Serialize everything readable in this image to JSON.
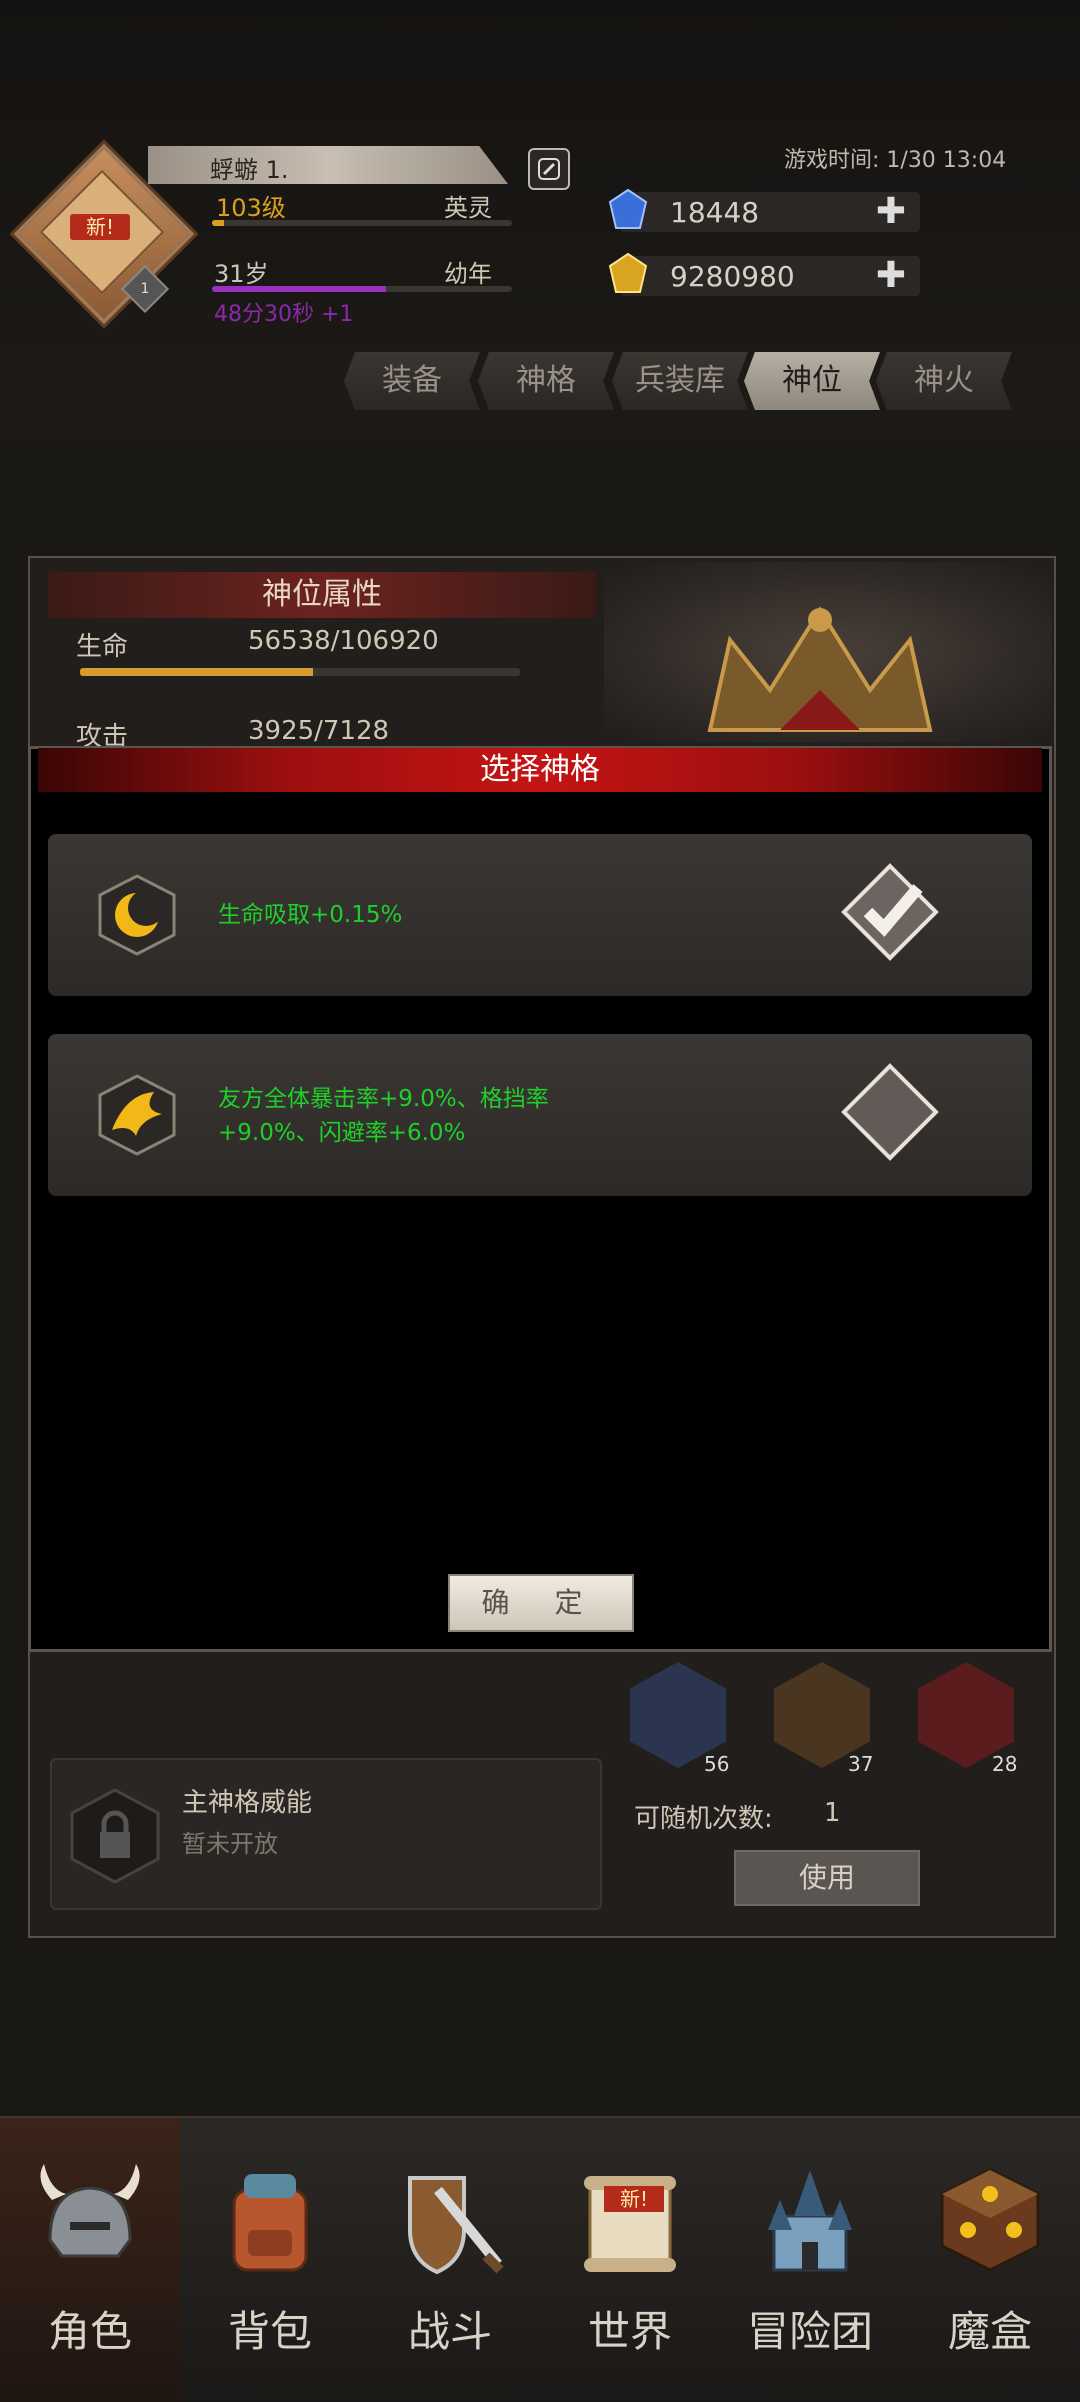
{
  "player": {
    "name": "蜉蝣 1.",
    "level": "103级",
    "rank": "英灵",
    "age": "31岁",
    "age_stage": "幼年",
    "timer": "48分30秒 +1",
    "avatar_badge": "新!",
    "avatar_level": "1"
  },
  "game_time": "游戏时间: 1/30 13:04",
  "resources": {
    "blue_gem": "18448",
    "gold_gem": "9280980"
  },
  "tabs": [
    "装备",
    "神格",
    "兵装库",
    "神位",
    "神火"
  ],
  "active_tab": "神位",
  "attributes": {
    "title": "神位属性",
    "hp_label": "生命",
    "hp_value": "56538/106920",
    "hp_fill": 0.53,
    "atk_label": "攻击",
    "atk_value": "3925/7128"
  },
  "modal": {
    "title": "选择神格",
    "options": [
      {
        "text": "生命吸取+0.15%",
        "selected": true,
        "icon": "crescent-moon-icon"
      },
      {
        "text_line1": "友方全体暴击率+9.0%、格挡率",
        "text_line2": "+9.0%、闪避率+6.0%",
        "selected": false,
        "icon": "wings-icon"
      }
    ],
    "confirm_label": "确 定"
  },
  "lower": {
    "lock_title": "主神格威能",
    "lock_sub": "暂未开放",
    "hex_counts": [
      "56",
      "37",
      "28"
    ],
    "random_label": "可随机次数:",
    "random_count": "1",
    "use_label": "使用"
  },
  "nav": [
    "角色",
    "背包",
    "战斗",
    "世界",
    "冒险团",
    "魔盒"
  ],
  "nav_new_badge": "新!",
  "colors": {
    "highlight_green": "#1ed12a",
    "modal_red": "#c41414"
  }
}
